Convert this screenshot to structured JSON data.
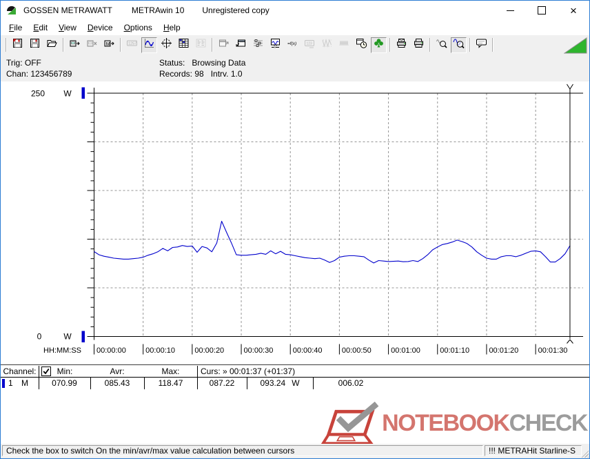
{
  "window": {
    "title_app": "GOSSEN METRAWATT",
    "title_product": "METRAwin 10",
    "title_status": "Unregistered copy",
    "controls": [
      "minimize-icon",
      "maximize-icon",
      "close-icon"
    ]
  },
  "menu": {
    "items": [
      {
        "label": "File"
      },
      {
        "label": "Edit"
      },
      {
        "label": "View"
      },
      {
        "label": "Device"
      },
      {
        "label": "Options"
      },
      {
        "label": "Help"
      }
    ]
  },
  "toolbar": {
    "buttons": [
      {
        "icon": "save-red-icon",
        "name": "save-button"
      },
      {
        "icon": "save-icon",
        "name": "save-as-button"
      },
      {
        "icon": "open-folder-icon",
        "name": "open-button"
      },
      {
        "icon": "device-read-icon",
        "name": "read-device-button",
        "sep": true
      },
      {
        "icon": "device-clear-icon",
        "name": "clear-device-button",
        "state": "disabled"
      },
      {
        "icon": "device-m-icon",
        "name": "device-memory-button"
      },
      {
        "icon": "lcd-display-icon",
        "name": "numeric-display-button",
        "state": "disabled",
        "sep": true
      },
      {
        "icon": "curve-graph-icon",
        "name": "graph-view-button",
        "state": "active"
      },
      {
        "icon": "crosshair-icon",
        "name": "cursor-mode-button"
      },
      {
        "icon": "table-grid-icon",
        "name": "table-view-button"
      },
      {
        "icon": "histogram-icon",
        "name": "statistics-view-button",
        "state": "disabled"
      },
      {
        "icon": "window-export-icon",
        "name": "export-window-button",
        "state": "disabled",
        "sep": true
      },
      {
        "icon": "window-import-icon",
        "name": "import-window-button"
      },
      {
        "icon": "sliders-icon",
        "name": "channel-scale-button"
      },
      {
        "icon": "monitor-wave-icon",
        "name": "online-monitor-button"
      },
      {
        "icon": "formula-icon",
        "name": "formula-button"
      },
      {
        "icon": "remote-display-icon",
        "name": "remote-display-button",
        "state": "disabled"
      },
      {
        "icon": "wave-minmax-icon",
        "name": "envelope-curve-button",
        "state": "disabled"
      },
      {
        "icon": "wave-dense-icon",
        "name": "dense-curve-button",
        "state": "disabled"
      },
      {
        "icon": "clock-window-icon",
        "name": "time-window-button"
      },
      {
        "icon": "clover-icon",
        "name": "condense-button",
        "state": "active"
      },
      {
        "icon": "print-mail-icon",
        "name": "print-report-button",
        "sep": true
      },
      {
        "icon": "printer-icon",
        "name": "print-button"
      },
      {
        "icon": "zoom-wave-icon",
        "name": "zoom-out-button",
        "sep": true
      },
      {
        "icon": "zoom-curve-icon",
        "name": "zoom-mode-button",
        "state": "active"
      },
      {
        "icon": "speech-bubble-icon",
        "name": "tooltip-button",
        "sep": true
      }
    ],
    "connection_indicator_color": "#2eb52e"
  },
  "info": {
    "trig": "Trig: OFF",
    "chan": "Chan: 123456789",
    "status": "Status:   Browsing Data",
    "records": "Records: 98   Intrv. 1.0"
  },
  "chart_data": {
    "type": "line",
    "y_axis_top_label": "250",
    "y_axis_bottom_label": "0",
    "ylabel_unit": "W",
    "ylim": [
      0,
      250
    ],
    "y_major_step": 50,
    "y_minor_step": 10,
    "grid": true,
    "x_axis_label": "HH:MM:SS",
    "x_ticks": [
      {
        "t": 0,
        "label": "00:00:00"
      },
      {
        "t": 10,
        "label": "00:00:10"
      },
      {
        "t": 20,
        "label": "00:00:20"
      },
      {
        "t": 30,
        "label": "00:00:30"
      },
      {
        "t": 40,
        "label": "00:00:40"
      },
      {
        "t": 50,
        "label": "00:00:50"
      },
      {
        "t": 60,
        "label": "00:01:00"
      },
      {
        "t": 70,
        "label": "00:01:10"
      },
      {
        "t": 80,
        "label": "00:01:20"
      },
      {
        "t": 90,
        "label": "00:01:30"
      }
    ],
    "sample_interval_s": 1.0,
    "records": 98,
    "series": [
      {
        "name": "channel-1-power",
        "color": "#0000cc",
        "values": [
          87.22,
          84,
          82.5,
          81.5,
          80.5,
          80,
          79.5,
          79.5,
          80,
          80.5,
          81.5,
          83.5,
          85,
          87,
          90.5,
          88,
          91.5,
          92,
          93.5,
          92.5,
          93,
          86.5,
          92.5,
          91,
          87,
          96,
          118.47,
          107,
          96,
          84,
          83.5,
          83.5,
          84,
          84.5,
          85.5,
          84.5,
          88,
          85,
          87.5,
          84.5,
          84,
          83,
          82,
          81,
          80.5,
          80,
          80.5,
          78.5,
          76,
          78,
          81.5,
          82.5,
          83,
          83,
          82.5,
          82,
          78.5,
          75.5,
          78,
          77.5,
          77,
          77.2,
          77.5,
          76.8,
          77,
          78,
          77,
          80,
          84,
          89,
          92,
          94.5,
          95.5,
          97,
          99,
          97.5,
          95.5,
          92,
          87,
          83.5,
          80.5,
          79.5,
          79.5,
          82,
          83,
          83,
          82,
          83.5,
          85.5,
          87.5,
          88,
          87,
          82,
          76.5,
          76.5,
          80,
          85,
          93.24
        ]
      }
    ],
    "cursor": {
      "t": 97,
      "time_label": "00:01:37"
    }
  },
  "table": {
    "header": {
      "channel": "Channel:",
      "checkbox_checked": true,
      "min": "Min:",
      "avr": "Avr:",
      "max": "Max:",
      "curs": "Curs: » 00:01:37 (+01:37)"
    },
    "rows": [
      {
        "marker_color": "#0000cc",
        "channel": "1",
        "mode": "M",
        "min": "070.99",
        "avr": "085.43",
        "max": "118.47",
        "cursor1": "087.22",
        "cursor2": "093.24",
        "unit": "W",
        "diff": "006.02"
      }
    ]
  },
  "watermark": {
    "primary": "NOTEBOOK",
    "secondary": "CHECK"
  },
  "status_bar": {
    "message": "Check the box to switch On the min/avr/max value calculation between cursors",
    "device": "!!! METRAHit Starline-S"
  },
  "colors": {
    "accent_border": "#2b7cd3",
    "series_blue": "#0000cc",
    "grid_gray": "#949494",
    "logo_red": "#d4756e",
    "logo_gray": "#9c9c9c"
  }
}
